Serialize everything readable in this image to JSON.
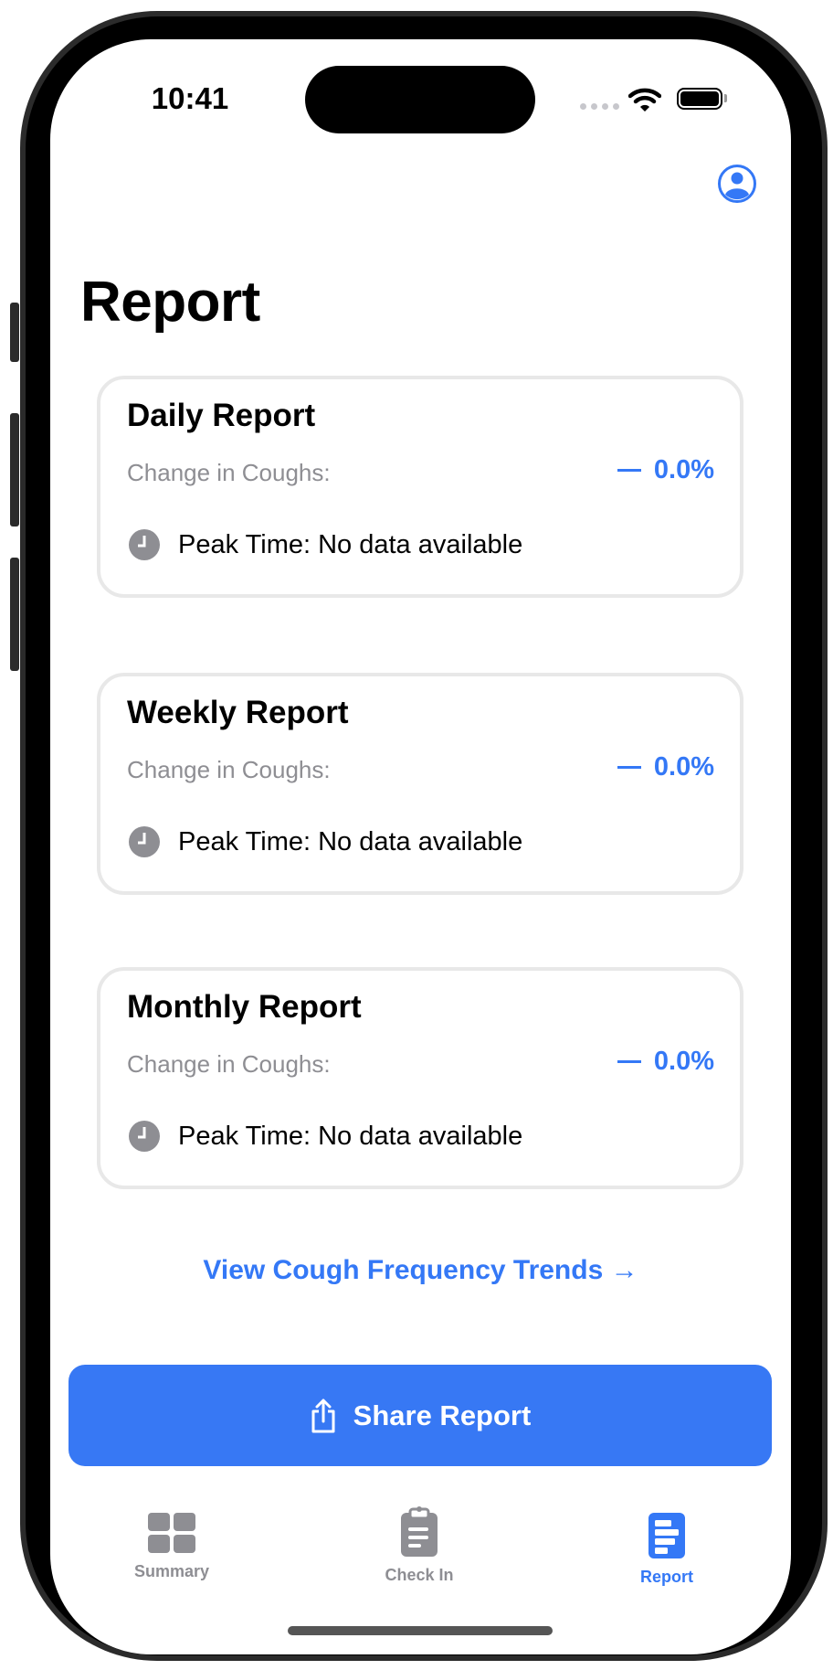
{
  "status_bar": {
    "time": "10:41"
  },
  "header": {
    "title": "Report",
    "profile_icon": "person-circle-icon"
  },
  "reports": [
    {
      "title": "Daily Report",
      "change_label": "Change in Coughs:",
      "change_value": "0.0%",
      "peak_text": "Peak Time: No data available"
    },
    {
      "title": "Weekly Report",
      "change_label": "Change in Coughs:",
      "change_value": "0.0%",
      "peak_text": "Peak Time: No data available"
    },
    {
      "title": "Monthly Report",
      "change_label": "Change in Coughs:",
      "change_value": "0.0%",
      "peak_text": "Peak Time: No data available"
    }
  ],
  "trends_link": "View Cough Frequency Trends →",
  "share_button": "Share Report",
  "tabs": [
    {
      "label": "Summary",
      "icon": "grid-icon"
    },
    {
      "label": "Check In",
      "icon": "clipboard-icon"
    },
    {
      "label": "Report",
      "icon": "report-icon",
      "active": true
    }
  ],
  "colors": {
    "accent": "#3478f6",
    "secondary_text": "#8e8e93",
    "card_border": "#e8e8e8"
  }
}
